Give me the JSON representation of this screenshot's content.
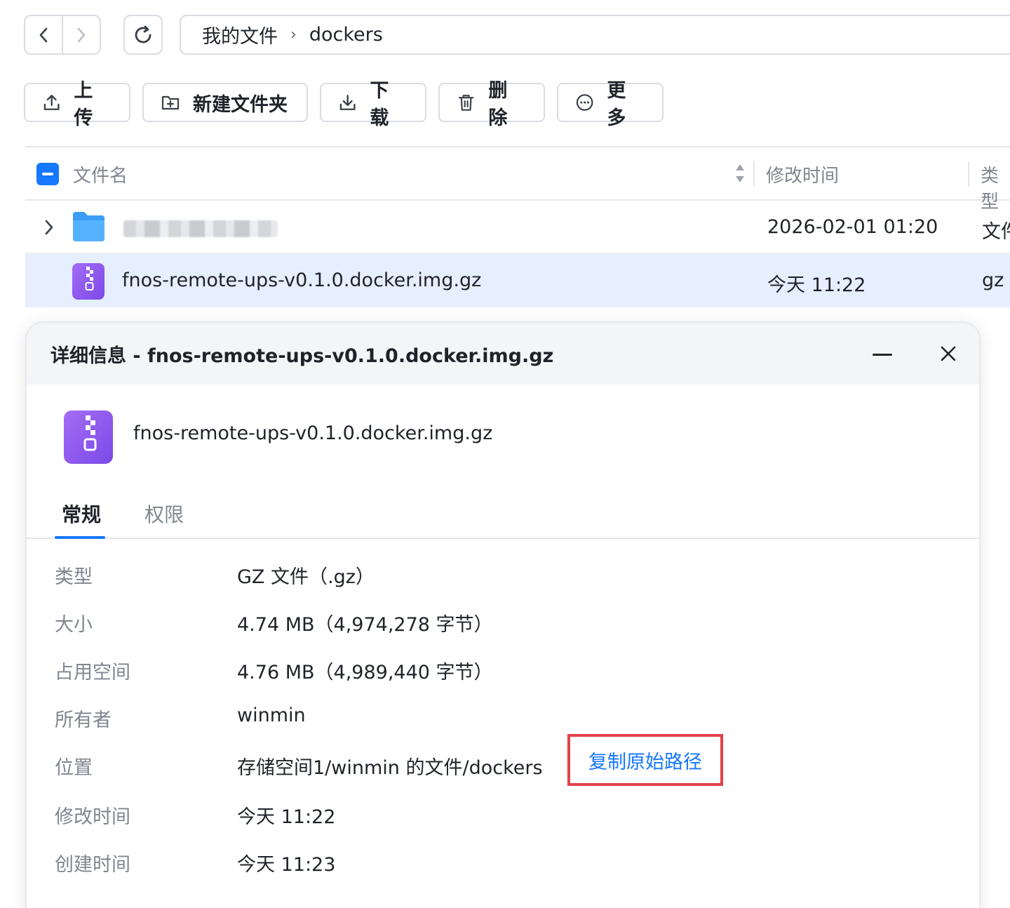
{
  "breadcrumb": {
    "root": "我的文件",
    "separator": "›",
    "current": "dockers"
  },
  "toolbar": {
    "upload": "上传",
    "new_folder": "新建文件夹",
    "download": "下载",
    "delete": "删除",
    "more": "更多"
  },
  "table": {
    "headers": {
      "name": "文件名",
      "modified": "修改时间",
      "type": "类型"
    },
    "rows": [
      {
        "name": "",
        "modified": "2026-02-01 01:20",
        "type": "文件"
      },
      {
        "name": "fnos-remote-ups-v0.1.0.docker.img.gz",
        "modified": "今天 11:22",
        "type": "gz"
      }
    ]
  },
  "details": {
    "title": "详细信息 - fnos-remote-ups-v0.1.0.docker.img.gz",
    "filename": "fnos-remote-ups-v0.1.0.docker.img.gz",
    "tabs": {
      "general": "常规",
      "permissions": "权限"
    },
    "props": [
      {
        "label": "类型",
        "value": "GZ 文件（.gz）"
      },
      {
        "label": "大小",
        "value": "4.74 MB（4,974,278 字节）"
      },
      {
        "label": "占用空间",
        "value": "4.76 MB（4,989,440 字节）"
      },
      {
        "label": "所有者",
        "value": "winmin"
      },
      {
        "label": "位置",
        "value": "存储空间1/winmin 的文件/dockers"
      },
      {
        "label": "修改时间",
        "value": "今天 11:22"
      },
      {
        "label": "创建时间",
        "value": "今天 11:23"
      }
    ],
    "copy_path": "复制原始路径"
  },
  "colors": {
    "accent": "#1677ff",
    "highlight_border": "#e4424a",
    "selected_row": "#e6efff"
  }
}
